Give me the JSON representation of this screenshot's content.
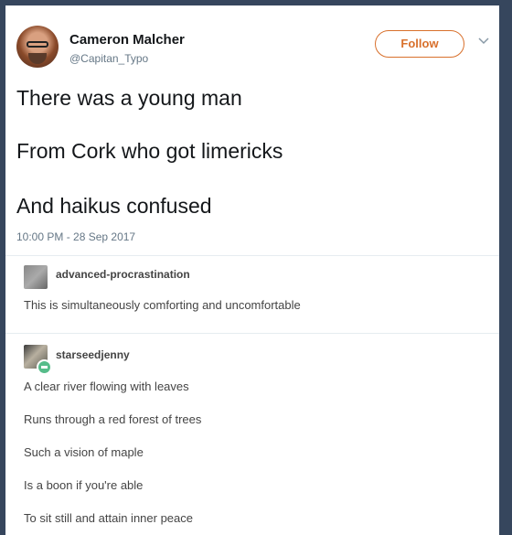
{
  "tweet": {
    "display_name": "Cameron Malcher",
    "handle": "@Capitan_Typo",
    "follow_label": "Follow",
    "lines": [
      "There was a young man",
      "From Cork who got limericks",
      "And haikus confused"
    ],
    "timestamp": "10:00 PM - 28 Sep 2017"
  },
  "reblogs": [
    {
      "username": "advanced-procrastination",
      "text": "This is simultaneously comforting and uncomfortable"
    },
    {
      "username": "starseedjenny",
      "lines": [
        "A clear river flowing with leaves",
        "Runs through a red forest of trees",
        "Such a vision of maple",
        "Is a boon if you're able",
        "To sit still and attain inner peace"
      ]
    }
  ],
  "colors": {
    "follow_accent": "#d8702c",
    "page_background": "#36465d",
    "badge": "#56bc8a"
  }
}
